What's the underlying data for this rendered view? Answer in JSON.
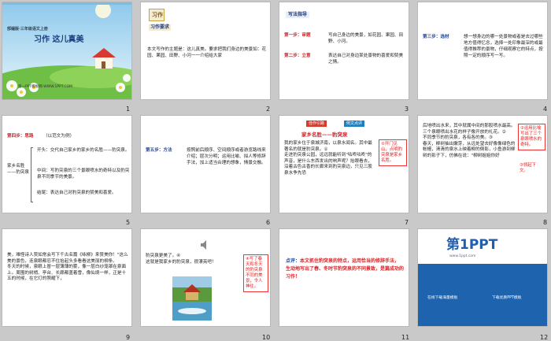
{
  "slides": [
    {
      "num": "1",
      "series": "部编版·三年级语文上册",
      "title": "习作  这儿真美",
      "footer": "第一PPT模板网-WWW.1PPT.COM"
    },
    {
      "num": "2",
      "tag_title": "习作",
      "tag_sub": "习作要求",
      "text": "本文写作的主题是：这儿真美。要求把我们身边的美景如：花园、果园、田野、小河一一介绍给大家"
    },
    {
      "num": "3",
      "header": "写法指导",
      "s1_label": "第一步：审题",
      "s1_text": "写自己身边的美景，如花园、果园、田野、小河。",
      "s2_label": "第二步：立意",
      "s2_text": "表达自己对身边某处景物的喜爱和赞美之情。"
    },
    {
      "num": "4",
      "s3_label": "第三步：选材",
      "s3_text": "想一想身边的哪一处景物或者是去过哪些地方值得忆念，选择一处印象最深的或最值得推荐的景物，仔细观察它的特点，按照一定的顺序写一写。"
    },
    {
      "num": "5",
      "s4_label": "第四步：思路",
      "s4_hint": "（以范文为例）",
      "left_title": "家乡名胜——豹突泉",
      "items": [
        "开头：交代自己家乡的家乡的名胜——豹突泉。",
        "中间：写豹突泉的三个景眼喷水的奇特以及豹突泉不同季节的美景。",
        "结尾：表达自己对豹突泉的赞美和喜爱。"
      ]
    },
    {
      "num": "6",
      "s5_label": "第五步：方法",
      "s5_text": "按照前后顺序、空间顺序或者游览路线来介绍；层次分明；运用比喻、拟人等修辞手法，加上适当合理的想象，情景交融。"
    },
    {
      "num": "7",
      "top_left": "佳作引路",
      "top_right": "例文点评",
      "title": "家乡名胜——豹突泉",
      "text": "我的家乡位于泉城济南，以泉水闻名。其中最著名的就是豹突泉。①\n走进豹突泉公园，远远就能听到\"咕咚咕咚\"的声音，是什么东西发出的响声呢？抬眼看去，沿着古色古香的长廊来到豹突泉边，只见三股泉水争先恐",
      "note": "①开门见山，点明豹突泉是家乡名胜。"
    },
    {
      "num": "8",
      "text": "后地喷出水来，其中就属中间的那股喷水最高。三个泉眼喷出水花的样子像开放的礼花。②\n不同季节的豹突泉，各有各的美。③\n春天，柳树抽出嫩芽，从远处望去好像像绿色的帐幔，清清的泉水上映着柳的倒影，小鱼游到柳树的影子下，仿佛在说：\"柳树姐姐你好",
      "note1": "②运用比喻写出了三个泉眼喷水的奇特。",
      "note2": "③领起下文。"
    },
    {
      "num": "9",
      "text": "美，难怪诗人贾如常会写下千古名篇《咏柳》来赞美你！\"这么美的景色，连泉眼都忍不住抬起头多看看这美丽的柳条。\n冬天的时候，泉眼上冒一层薄薄的雾，像一层白纱笼罩在泉面上。周围的树梢、亭台、长廊都盖着雪，像仙境一样，正是十五的时候，在它灯的照耀下，"
    },
    {
      "num": "10",
      "text": "豹突泉更美了。④\n这就是我家乡的豹突泉，很漂亮吧！",
      "note": "④写了春天和冬天的豹突泉不同的美景，令人神往。"
    },
    {
      "num": "11",
      "label": "点评：",
      "text": "本文抓住豹突泉的特点，运用恰当的修辞手法，生动地写出了春、冬时节豹突泉的不同景致，是篇成功的习作！"
    },
    {
      "num": "12",
      "logo": "第1PPT",
      "logo_sub": "www.1ppt.com",
      "btn1": "在线下载海量模板",
      "btn2": "下载优质PPT模板"
    }
  ]
}
